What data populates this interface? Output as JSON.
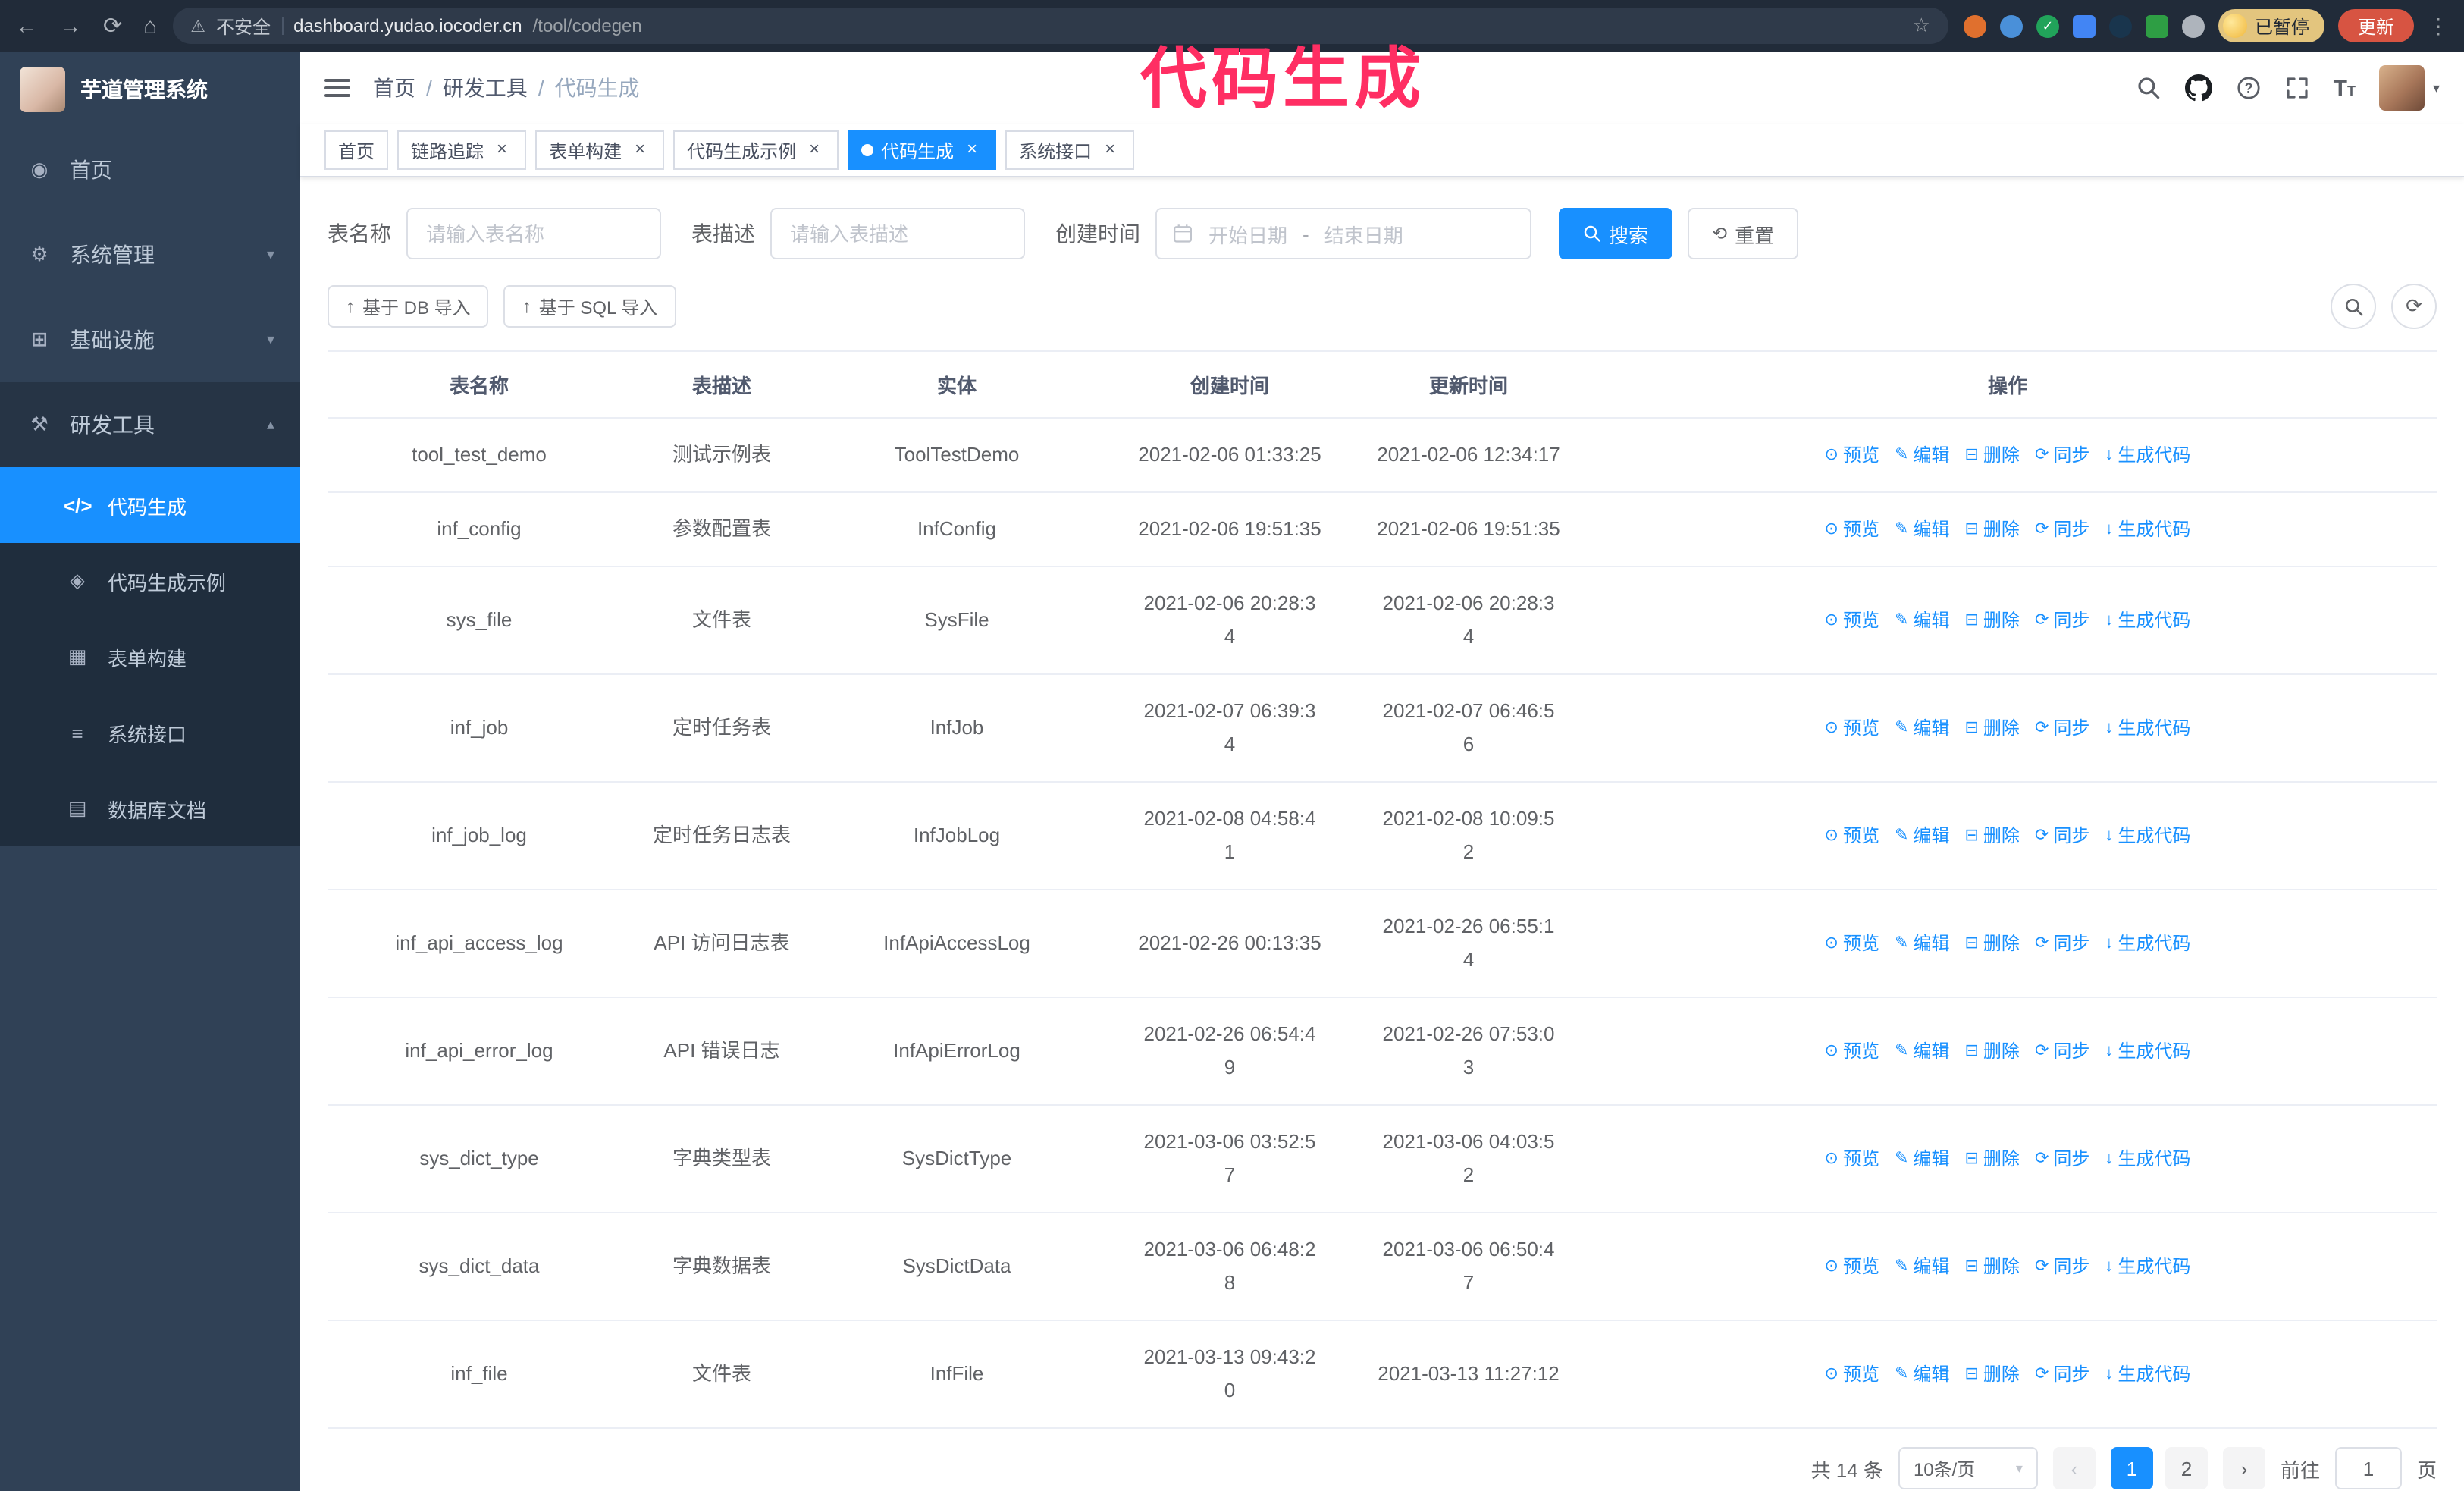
{
  "theme": {
    "accent": "#1890ff",
    "sidebar_bg": "#304156",
    "submenu_bg": "#1f2d3d",
    "annotation_color": "#ff2e63",
    "update_button_bg": "#d75442",
    "paused_badge_bg": "#e3c57e"
  },
  "annotation": {
    "text": "代码生成"
  },
  "browser": {
    "security_label": "不安全",
    "url_host": "dashboard.yudao.iocoder.cn",
    "url_path": "/tool/codegen",
    "paused_badge": "已暂停",
    "update_button": "更新"
  },
  "sidebar": {
    "logo_title": "芋道管理系统",
    "menu": [
      {
        "key": "home",
        "label": "首页",
        "icon": "home-icon"
      },
      {
        "key": "system",
        "label": "系统管理",
        "icon": "gear-icon",
        "chevron": "down"
      },
      {
        "key": "infra",
        "label": "基础设施",
        "icon": "infra-icon",
        "chevron": "down"
      },
      {
        "key": "devtools",
        "label": "研发工具",
        "icon": "tools-icon",
        "chevron": "up",
        "expanded": true
      }
    ],
    "submenu": [
      {
        "key": "codegen",
        "label": "代码生成",
        "icon": "code-icon",
        "active": true
      },
      {
        "key": "codegen-example",
        "label": "代码生成示例",
        "icon": "example-icon"
      },
      {
        "key": "form-build",
        "label": "表单构建",
        "icon": "form-icon"
      },
      {
        "key": "api",
        "label": "系统接口",
        "icon": "api-icon"
      },
      {
        "key": "db-doc",
        "label": "数据库文档",
        "icon": "db-icon"
      }
    ]
  },
  "navbar": {
    "breadcrumb": [
      "首页",
      "研发工具",
      "代码生成"
    ]
  },
  "tabs": [
    {
      "key": "home",
      "label": "首页",
      "closable": false
    },
    {
      "key": "tracer",
      "label": "链路追踪",
      "closable": true
    },
    {
      "key": "form-build",
      "label": "表单构建",
      "closable": true
    },
    {
      "key": "codegen-example",
      "label": "代码生成示例",
      "closable": true
    },
    {
      "key": "codegen",
      "label": "代码生成",
      "closable": true,
      "active": true
    },
    {
      "key": "api",
      "label": "系统接口",
      "closable": true
    }
  ],
  "filters": {
    "table_name_label": "表名称",
    "table_name_placeholder": "请输入表名称",
    "table_desc_label": "表描述",
    "table_desc_placeholder": "请输入表描述",
    "create_time_label": "创建时间",
    "date_start_placeholder": "开始日期",
    "date_separator": "-",
    "date_end_placeholder": "结束日期",
    "search_button": "搜索",
    "reset_button": "重置"
  },
  "toolbar": {
    "import_db_button": "基于 DB 导入",
    "import_sql_button": "基于 SQL 导入"
  },
  "table": {
    "columns": [
      "表名称",
      "表描述",
      "实体",
      "创建时间",
      "更新时间",
      "操作"
    ],
    "row_actions": [
      {
        "key": "preview",
        "label": "预览",
        "icon": "eye-icon"
      },
      {
        "key": "edit",
        "label": "编辑",
        "icon": "edit-icon"
      },
      {
        "key": "delete",
        "label": "删除",
        "icon": "delete-icon"
      },
      {
        "key": "sync",
        "label": "同步",
        "icon": "sync-icon"
      },
      {
        "key": "generate",
        "label": "生成代码",
        "icon": "download-icon"
      }
    ],
    "rows": [
      {
        "name": "tool_test_demo",
        "desc": "测试示例表",
        "entity": "ToolTestDemo",
        "created": "2021-02-06 01:33:25",
        "updated": "2021-02-06 12:34:17"
      },
      {
        "name": "inf_config",
        "desc": "参数配置表",
        "entity": "InfConfig",
        "created": "2021-02-06 19:51:35",
        "updated": "2021-02-06 19:51:35"
      },
      {
        "name": "sys_file",
        "desc": "文件表",
        "entity": "SysFile",
        "created": "2021-02-06 20:28:3\n4",
        "updated": "2021-02-06 20:28:3\n4"
      },
      {
        "name": "inf_job",
        "desc": "定时任务表",
        "entity": "InfJob",
        "created": "2021-02-07 06:39:3\n4",
        "updated": "2021-02-07 06:46:5\n6"
      },
      {
        "name": "inf_job_log",
        "desc": "定时任务日志表",
        "entity": "InfJobLog",
        "created": "2021-02-08 04:58:4\n1",
        "updated": "2021-02-08 10:09:5\n2"
      },
      {
        "name": "inf_api_access_log",
        "desc": "API 访问日志表",
        "entity": "InfApiAccessLog",
        "created": "2021-02-26 00:13:35",
        "updated": "2021-02-26 06:55:1\n4"
      },
      {
        "name": "inf_api_error_log",
        "desc": "API 错误日志",
        "entity": "InfApiErrorLog",
        "created": "2021-02-26 06:54:4\n9",
        "updated": "2021-02-26 07:53:0\n3"
      },
      {
        "name": "sys_dict_type",
        "desc": "字典类型表",
        "entity": "SysDictType",
        "created": "2021-03-06 03:52:5\n7",
        "updated": "2021-03-06 04:03:5\n2"
      },
      {
        "name": "sys_dict_data",
        "desc": "字典数据表",
        "entity": "SysDictData",
        "created": "2021-03-06 06:48:2\n8",
        "updated": "2021-03-06 06:50:4\n7"
      },
      {
        "name": "inf_file",
        "desc": "文件表",
        "entity": "InfFile",
        "created": "2021-03-13 09:43:2\n0",
        "updated": "2021-03-13 11:27:12"
      }
    ]
  },
  "pagination": {
    "total_text": "共 14 条",
    "page_size": "10条/页",
    "pages": [
      "1",
      "2"
    ],
    "active_page": "1",
    "goto_label": "前往",
    "goto_value": "1",
    "goto_suffix": "页"
  }
}
